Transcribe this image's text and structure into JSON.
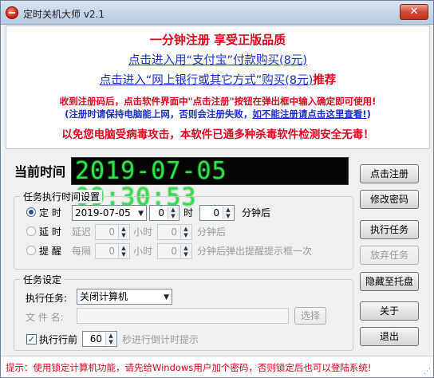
{
  "window": {
    "title": "定时关机大师 v2.1",
    "close_glyph": "✕"
  },
  "promo": {
    "line1": "一分钟注册  享受正版品质",
    "line2": "点击进入用“支付宝”付款购买(8元)",
    "line3_link": "点击进入“网上银行或其它方式”购买(8元)",
    "line3_suffix": "推荐",
    "line4": "收到注册码后，点击软件界面中\"点击注册\"按钮在弹出框中输入确定即可使用!",
    "line5_text": "(注册时请保持电脑能上网，否则会注册失败，",
    "line5_link": "如不能注册请点击这里查看!",
    "line5_end": ")",
    "line6": "以免您电脑受病毒攻击，本软件已通多种杀毒软件检测安全无毒！"
  },
  "clock": {
    "label": "当前时间",
    "value": "2019-07-05  09:30:53"
  },
  "sidebar": {
    "register": "点击注册",
    "change_password": "修改密码",
    "run_task": "执行任务",
    "abandon_task": "放弃任务",
    "hide_tray": "隐藏至托盘",
    "about": "关于",
    "exit": "退出"
  },
  "time_settings": {
    "title": "任务执行时间设置",
    "timed_label": "定 时",
    "date_value": "2019-07-05",
    "hour_value": "0",
    "hour_unit": "时",
    "minute_value": "0",
    "minute_unit": "分钟后",
    "delay_label": "延 时",
    "delay_prefix": "延迟",
    "delay_hours": "0",
    "delay_hours_unit": "小时",
    "delay_minutes": "0",
    "delay_minutes_unit": "分钟后",
    "remind_label": "提 醒",
    "remind_prefix": "每隔",
    "remind_hours": "0",
    "remind_hours_unit": "小时",
    "remind_minutes": "0",
    "remind_minutes_unit": "分钟后弹出提醒提示框一次"
  },
  "task_settings": {
    "title": "任务设定",
    "execute_label": "执行任务:",
    "execute_value": "关闭计算机",
    "filename_label": "文 件 名:",
    "filename_value": "",
    "browse_button": "选择",
    "countdown_check_label": "执行行前",
    "countdown_value": "60",
    "countdown_suffix": "秒进行倒计时提示"
  },
  "footer": {
    "hint": "提示：使用锁定计算机功能，请先给Windows用户加个密码，否则锁定后也可以登陆系统!"
  }
}
